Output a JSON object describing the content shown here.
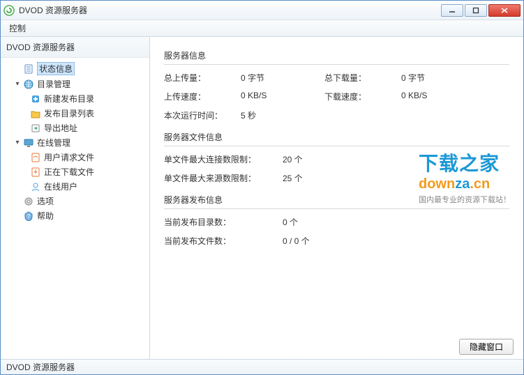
{
  "window": {
    "title": "DVOD 资源服务器"
  },
  "menubar": {
    "control": "控制"
  },
  "sidebar": {
    "header": "DVOD 资源服务器",
    "items": {
      "status": "状态信息",
      "dirMgmt": "目录管理",
      "newPublishDir": "新建发布目录",
      "publishDirList": "发布目录列表",
      "exportAddr": "导出地址",
      "onlineMgmt": "在线管理",
      "userReqFiles": "用户请求文件",
      "downloadingFiles": "正在下载文件",
      "onlineUsers": "在线用户",
      "options": "选项",
      "help": "帮助"
    }
  },
  "content": {
    "serverInfo": {
      "title": "服务器信息",
      "totalUpload": {
        "label": "总上传量：",
        "value": "0 字节"
      },
      "totalDownload": {
        "label": "总下载量：",
        "value": "0 字节"
      },
      "uploadSpeed": {
        "label": "上传速度：",
        "value": "0 KB/S"
      },
      "downloadSpeed": {
        "label": "下载速度：",
        "value": "0 KB/S"
      },
      "runtime": {
        "label": "本次运行时间：",
        "value": "5 秒"
      }
    },
    "fileInfo": {
      "title": "服务器文件信息",
      "maxConn": {
        "label": "单文件最大连接数限制：",
        "value": "20 个"
      },
      "maxSource": {
        "label": "单文件最大来源数限制：",
        "value": "25 个"
      }
    },
    "publishInfo": {
      "title": "服务器发布信息",
      "dirCount": {
        "label": "当前发布目录数：",
        "value": "0 个"
      },
      "fileCount": {
        "label": "当前发布文件数：",
        "value": "0 / 0 个"
      }
    },
    "hideBtn": "隐藏窗口"
  },
  "watermark": {
    "cn": "下载之家",
    "en1": "down",
    "en2": "za",
    "en3": ".cn",
    "sub": "国内最专业的资源下载站！"
  },
  "statusbar": {
    "text": "DVOD 资源服务器"
  }
}
